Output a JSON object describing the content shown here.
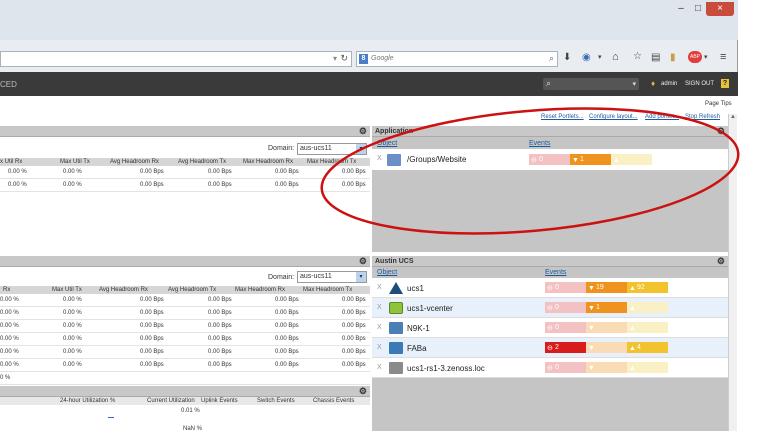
{
  "browser": {
    "search_placeholder": "Google",
    "search_engine_icon": "google-icon",
    "window_buttons": [
      "–",
      "□",
      "×"
    ]
  },
  "appbar": {
    "left_text": "CED",
    "user": "admin",
    "signout": "SIGN OUT",
    "help": "?"
  },
  "page": {
    "page_tips": "Page Tips",
    "links": [
      "Reset Portlets...",
      "Configure layout...",
      "Add portlet...",
      "Stop Refresh"
    ]
  },
  "left_top": {
    "domain_label": "Domain:",
    "domain_value": "aus-ucs11",
    "columns": [
      "x Util Rx",
      "Max Util Tx",
      "Avg Headroom Rx",
      "Avg Headroom Tx",
      "Max Headroom Rx",
      "Max Headroom Tx"
    ],
    "rows": [
      [
        "0.00 %",
        "0.00 %",
        "0.00 Bps",
        "0.00 Bps",
        "0.00 Bps",
        "0.00 Bps"
      ],
      [
        "0.00 %",
        "0.00 %",
        "0.00 Bps",
        "0.00 Bps",
        "0.00 Bps",
        "0.00 Bps"
      ]
    ]
  },
  "left_mid": {
    "domain_label": "Domain:",
    "domain_value": "aus-ucs11",
    "columns": [
      "Rx",
      "Max Util Tx",
      "Avg Headroom Rx",
      "Avg Headroom Tx",
      "Max Headroom Rx",
      "Max Headroom Tx"
    ],
    "rows": [
      [
        "0.00 %",
        "0.00 %",
        "0.00 Bps",
        "0.00 Bps",
        "0.00 Bps",
        "0.00 Bps"
      ],
      [
        "0.00 %",
        "0.00 %",
        "0.00 Bps",
        "0.00 Bps",
        "0.00 Bps",
        "0.00 Bps"
      ],
      [
        "0.00 %",
        "0.00 %",
        "0.00 Bps",
        "0.00 Bps",
        "0.00 Bps",
        "0.00 Bps"
      ],
      [
        "0.00 %",
        "0.00 %",
        "0.00 Bps",
        "0.00 Bps",
        "0.00 Bps",
        "0.00 Bps"
      ],
      [
        "0.00 %",
        "0.00 %",
        "0.00 Bps",
        "0.00 Bps",
        "0.00 Bps",
        "0.00 Bps"
      ],
      [
        "0.00 %",
        "0.00 %",
        "0.00 Bps",
        "0.00 Bps",
        "0.00 Bps",
        "0.00 Bps"
      ],
      [
        "0 %",
        "",
        "",
        "",
        "",
        ""
      ]
    ]
  },
  "left_bottom": {
    "columns": [
      "24-hour Utilization %",
      "Current Utilization",
      "Uplink Events",
      "Switch Events",
      "Chassis Events"
    ],
    "value1": "0.01 %",
    "value2": "NaN %"
  },
  "application": {
    "title": "Application",
    "col_object": "Object",
    "col_events": "Events",
    "rows": [
      {
        "name": "/Groups/Website",
        "critical": "0",
        "error": "1",
        "warning": ""
      }
    ]
  },
  "austin": {
    "title": "Austin UCS",
    "col_object": "Object",
    "col_events": "Events",
    "rows": [
      {
        "name": "ucs1",
        "critical": "0",
        "error": "19",
        "warning": "92",
        "icon": "ucs-chassis-icon"
      },
      {
        "name": "ucs1-vcenter",
        "critical": "0",
        "error": "1",
        "warning": "",
        "icon": "vcenter-icon"
      },
      {
        "name": "N9K-1",
        "critical": "0",
        "error": "",
        "warning": "",
        "icon": "switch-icon"
      },
      {
        "name": "FABa",
        "critical": "2",
        "error": "",
        "warning": "4",
        "icon": "fabric-icon"
      },
      {
        "name": "ucs1-rs1-3.zenoss.loc",
        "critical": "0",
        "error": "",
        "warning": "",
        "icon": "server-icon"
      }
    ]
  },
  "colors": {
    "annotation": "#cc1111",
    "critical": "#d81b1b",
    "error": "#f0921e",
    "warning": "#f2c32c"
  }
}
